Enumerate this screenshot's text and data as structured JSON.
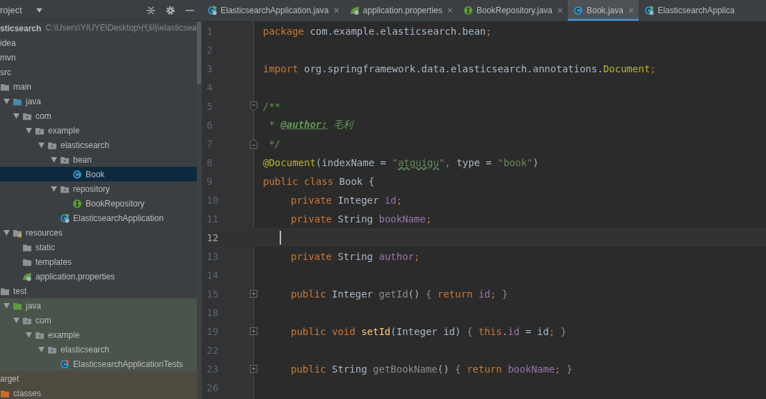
{
  "project_panel": {
    "title": "roject"
  },
  "tree": [
    {
      "name": "sticsearch",
      "path": "C:\\Users\\YIUYE\\Desktop\\代码\\elasticsea",
      "selected": false
    },
    {
      "name": "idea",
      "selected": false
    },
    {
      "name": "mvn",
      "selected": false
    },
    {
      "name": "src",
      "selected": false,
      "children": [
        {
          "name": "main",
          "kind": "folder",
          "selected": false,
          "children": [
            {
              "name": "java",
              "kind": "source-folder",
              "expanded": true,
              "selected": false,
              "children": [
                {
                  "name": "com",
                  "kind": "package",
                  "expanded": true,
                  "selected": false,
                  "children": [
                    {
                      "name": "example",
                      "kind": "package",
                      "expanded": true,
                      "selected": false,
                      "children": [
                        {
                          "name": "elasticsearch",
                          "kind": "package",
                          "expanded": true,
                          "selected": false,
                          "children": [
                            {
                              "name": "bean",
                              "kind": "package",
                              "expanded": true,
                              "selected": false,
                              "children": [
                                {
                                  "name": "Book",
                                  "kind": "class",
                                  "selected": true
                                }
                              ]
                            },
                            {
                              "name": "repository",
                              "kind": "package",
                              "expanded": true,
                              "selected": false,
                              "children": [
                                {
                                  "name": "BookRepository",
                                  "kind": "interface",
                                  "selected": false
                                }
                              ]
                            },
                            {
                              "name": "ElasticsearchApplication",
                              "kind": "spring-class",
                              "selected": false
                            }
                          ]
                        }
                      ]
                    }
                  ]
                }
              ]
            },
            {
              "name": "resources",
              "kind": "resources-folder",
              "expanded": true,
              "selected": false,
              "children": [
                {
                  "name": "static",
                  "kind": "folder",
                  "selected": false
                },
                {
                  "name": "templates",
                  "kind": "folder",
                  "selected": false
                },
                {
                  "name": "application.properties",
                  "kind": "properties",
                  "selected": false
                }
              ]
            }
          ]
        },
        {
          "name": "test",
          "kind": "folder",
          "selected": false,
          "children": [
            {
              "name": "java",
              "kind": "test-folder",
              "expanded": true,
              "selected": false,
              "children": [
                {
                  "name": "com",
                  "kind": "package",
                  "expanded": true,
                  "selected": false,
                  "children": [
                    {
                      "name": "example",
                      "kind": "package",
                      "expanded": true,
                      "selected": false,
                      "children": [
                        {
                          "name": "elasticsearch",
                          "kind": "package",
                          "expanded": true,
                          "selected": false,
                          "children": [
                            {
                              "name": "ElasticsearchApplicationTests",
                              "kind": "test-class",
                              "selected": false
                            }
                          ]
                        }
                      ]
                    }
                  ]
                }
              ]
            }
          ]
        }
      ]
    },
    {
      "name": "arget",
      "kind": "excluded-folder",
      "selected": false,
      "children": [
        {
          "name": "classes",
          "kind": "excluded-folder",
          "selected": false
        }
      ]
    }
  ],
  "tabs": [
    {
      "label": "ElasticsearchApplication.java",
      "kind": "spring-class",
      "closable": true,
      "selected": false
    },
    {
      "label": "application.properties",
      "kind": "properties",
      "closable": true,
      "selected": false
    },
    {
      "label": "BookRepository.java",
      "kind": "interface",
      "closable": true,
      "selected": false
    },
    {
      "label": "Book.java",
      "kind": "class",
      "closable": true,
      "selected": true
    },
    {
      "label": "ElasticsearchApplica",
      "kind": "spring-class",
      "closable": false,
      "selected": false
    }
  ],
  "close_glyph": "×",
  "code_lines": [
    {
      "number": "1",
      "tokens": [
        {
          "kind": "kw",
          "text": "package "
        },
        {
          "kind": "id",
          "text": "com.example.elasticsearch.bean"
        },
        {
          "kind": "kw",
          "text": ";"
        }
      ]
    },
    {
      "number": "2"
    },
    {
      "number": "3",
      "tokens": [
        {
          "kind": "kw",
          "text": "import "
        },
        {
          "kind": "id",
          "text": "org.springframework.data.elasticsearch.annotations."
        },
        {
          "kind": "ann",
          "text": "Document"
        },
        {
          "kind": "kw",
          "text": ";"
        }
      ]
    },
    {
      "number": "4"
    },
    {
      "number": "5",
      "kind": "fold-start",
      "tokens": [
        {
          "kind": "doc",
          "text": "/**"
        }
      ]
    },
    {
      "number": "6",
      "tokens": [
        {
          "kind": "doc",
          "text": " * "
        },
        {
          "kind": "tag",
          "text": "@author:"
        },
        {
          "kind": "doc",
          "text": " 毛利"
        }
      ]
    },
    {
      "number": "7",
      "kind": "fold-end",
      "tokens": [
        {
          "kind": "doc",
          "text": " */"
        }
      ]
    },
    {
      "number": "8",
      "tokens": [
        {
          "kind": "ann",
          "text": "@Document"
        },
        {
          "kind": "id",
          "text": "(indexName = "
        },
        {
          "kind": "str",
          "text": "\""
        },
        {
          "kind": "typo",
          "text": "atguigu"
        },
        {
          "kind": "str",
          "text": "\""
        },
        {
          "kind": "kw",
          "text": ", "
        },
        {
          "kind": "id",
          "text": "type = "
        },
        {
          "kind": "str",
          "text": "\"book\""
        },
        {
          "kind": "id",
          "text": ")"
        }
      ]
    },
    {
      "number": "9",
      "tokens": [
        {
          "kind": "kw",
          "text": "public class "
        },
        {
          "kind": "id",
          "text": "Book {"
        }
      ]
    },
    {
      "number": "10",
      "indented": true,
      "tokens": [
        {
          "kind": "kw",
          "text": "private "
        },
        {
          "kind": "id",
          "text": "Integer "
        },
        {
          "kind": "field",
          "text": "id"
        },
        {
          "kind": "kw",
          "text": ";"
        }
      ]
    },
    {
      "number": "11",
      "indented": true,
      "tokens": [
        {
          "kind": "kw",
          "text": "private "
        },
        {
          "kind": "id",
          "text": "String "
        },
        {
          "kind": "field",
          "text": "bookName"
        },
        {
          "kind": "kw",
          "text": ";"
        }
      ]
    },
    {
      "number": "12",
      "indented": true,
      "current": true
    },
    {
      "number": "13",
      "indented": true,
      "tokens": [
        {
          "kind": "kw",
          "text": "private "
        },
        {
          "kind": "id",
          "text": "String "
        },
        {
          "kind": "field",
          "text": "author"
        },
        {
          "kind": "kw",
          "text": ";"
        }
      ]
    },
    {
      "number": "14"
    },
    {
      "number": "15",
      "indented": true,
      "kind": "folded",
      "tokens": [
        {
          "kind": "kw",
          "text": "public "
        },
        {
          "kind": "id",
          "text": "Integer "
        },
        {
          "kind": "dim",
          "text": "getId"
        },
        {
          "kind": "id",
          "text": "() "
        },
        {
          "kind": "brace",
          "text": "{ "
        },
        {
          "kind": "kw",
          "text": "return "
        },
        {
          "kind": "field",
          "text": "id"
        },
        {
          "kind": "kw",
          "text": ";"
        },
        {
          "kind": "brace",
          "text": " }"
        }
      ]
    },
    {
      "number": "18"
    },
    {
      "number": "19",
      "indented": true,
      "kind": "folded",
      "tokens": [
        {
          "kind": "kw",
          "text": "public void "
        },
        {
          "kind": "decl",
          "text": "setId"
        },
        {
          "kind": "id",
          "text": "(Integer id) "
        },
        {
          "kind": "brace",
          "text": "{ "
        },
        {
          "kind": "kw",
          "text": "this"
        },
        {
          "kind": "id",
          "text": "."
        },
        {
          "kind": "field",
          "text": "id"
        },
        {
          "kind": "id",
          "text": " = id"
        },
        {
          "kind": "kw",
          "text": ";"
        },
        {
          "kind": "brace",
          "text": " }"
        }
      ]
    },
    {
      "number": "22"
    },
    {
      "number": "23",
      "indented": true,
      "kind": "folded",
      "tokens": [
        {
          "kind": "kw",
          "text": "public "
        },
        {
          "kind": "id",
          "text": "String "
        },
        {
          "kind": "dim",
          "text": "getBookName"
        },
        {
          "kind": "id",
          "text": "() "
        },
        {
          "kind": "brace",
          "text": "{ "
        },
        {
          "kind": "kw",
          "text": "return "
        },
        {
          "kind": "field",
          "text": "bookName"
        },
        {
          "kind": "kw",
          "text": ";"
        },
        {
          "kind": "brace",
          "text": " }"
        }
      ]
    },
    {
      "number": "26"
    }
  ]
}
